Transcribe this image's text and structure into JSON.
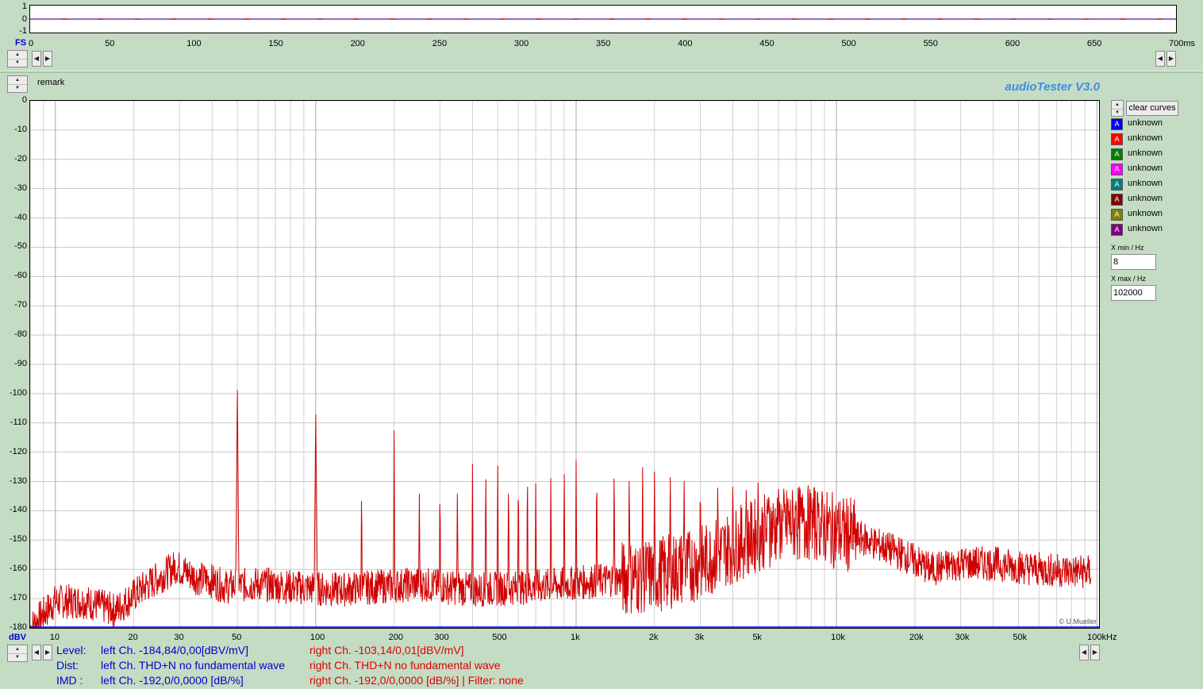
{
  "scope": {
    "y_ticks": [
      "1",
      "0",
      "-1"
    ],
    "unit_label": "FS",
    "x_ticks": [
      "0",
      "50",
      "100",
      "150",
      "200",
      "250",
      "300",
      "350",
      "400",
      "450",
      "500",
      "550",
      "600",
      "650",
      "700ms"
    ]
  },
  "header": {
    "remark": "remark",
    "brand": "audioTester  V3.0"
  },
  "chart_data": {
    "type": "line",
    "x_scale": "log",
    "xlim": [
      8,
      102000
    ],
    "ylim": [
      -180,
      0
    ],
    "ylabel": "dBV",
    "y_ticks": [
      "0",
      "-10",
      "-20",
      "-30",
      "-40",
      "-50",
      "-60",
      "-70",
      "-80",
      "-90",
      "-100",
      "-110",
      "-120",
      "-130",
      "-140",
      "-150",
      "-160",
      "-170",
      "-180"
    ],
    "x_tick_values": [
      10,
      20,
      30,
      50,
      100,
      200,
      300,
      500,
      1000,
      2000,
      3000,
      5000,
      10000,
      20000,
      30000,
      50000,
      100000
    ],
    "x_tick_labels": [
      "10",
      "20",
      "30",
      "50",
      "100",
      "200",
      "300",
      "500",
      "1k",
      "2k",
      "3k",
      "5k",
      "10k",
      "20k",
      "30k",
      "50k",
      "100kHz"
    ],
    "series": [
      {
        "color": "#d00000",
        "floor_points": [
          [
            8,
            -180
          ],
          [
            10,
            -171
          ],
          [
            13,
            -171
          ],
          [
            17,
            -174
          ],
          [
            22,
            -166
          ],
          [
            27,
            -161
          ],
          [
            29,
            -159
          ],
          [
            35,
            -163
          ],
          [
            40,
            -164
          ],
          [
            45,
            -166
          ],
          [
            60,
            -165
          ],
          [
            80,
            -166
          ],
          [
            120,
            -167
          ],
          [
            170,
            -166
          ],
          [
            250,
            -165
          ],
          [
            400,
            -167
          ],
          [
            700,
            -166
          ],
          [
            1200,
            -164
          ],
          [
            2000,
            -162
          ],
          [
            3000,
            -158
          ],
          [
            4000,
            -152
          ],
          [
            6000,
            -145
          ],
          [
            8000,
            -144
          ],
          [
            10000,
            -147
          ],
          [
            13000,
            -150
          ],
          [
            18000,
            -155
          ],
          [
            23000,
            -160
          ],
          [
            30000,
            -158
          ],
          [
            40000,
            -158
          ],
          [
            60000,
            -160
          ],
          [
            95000,
            -161
          ]
        ],
        "peaks": [
          [
            50,
            -96
          ],
          [
            100,
            -106
          ],
          [
            150,
            -130
          ],
          [
            200,
            -112
          ],
          [
            250,
            -131
          ],
          [
            300,
            -129
          ],
          [
            350,
            -132
          ],
          [
            400,
            -121
          ],
          [
            450,
            -122
          ],
          [
            500,
            -123
          ],
          [
            550,
            -125
          ],
          [
            600,
            -124
          ],
          [
            650,
            -122
          ],
          [
            700,
            -126
          ],
          [
            800,
            -124
          ],
          [
            900,
            -123
          ],
          [
            1000,
            -122
          ],
          [
            1200,
            -122
          ],
          [
            1400,
            -122
          ],
          [
            1600,
            -123
          ],
          [
            1800,
            -123
          ],
          [
            2000,
            -124
          ],
          [
            2300,
            -125
          ],
          [
            2600,
            -126
          ],
          [
            3000,
            -128
          ],
          [
            3500,
            -129
          ],
          [
            4000,
            -129
          ],
          [
            4500,
            -131
          ],
          [
            5000,
            -130
          ],
          [
            5500,
            -131
          ],
          [
            6000,
            -133
          ],
          [
            6500,
            -134
          ],
          [
            7000,
            -135
          ],
          [
            7500,
            -137
          ],
          [
            8000,
            -138
          ],
          [
            8500,
            -139
          ],
          [
            9000,
            -140
          ]
        ]
      }
    ]
  },
  "legend": {
    "clear_label": "clear curves",
    "items": [
      {
        "label": "unknown",
        "color": "#0000ff"
      },
      {
        "label": "unknown",
        "color": "#ff0000"
      },
      {
        "label": "unknown",
        "color": "#008000"
      },
      {
        "label": "unknown",
        "color": "#ff00ff"
      },
      {
        "label": "unknown",
        "color": "#008080"
      },
      {
        "label": "unknown",
        "color": "#800000"
      },
      {
        "label": "unknown",
        "color": "#808000"
      },
      {
        "label": "unknown",
        "color": "#800080"
      }
    ],
    "icon_glyph": "A"
  },
  "axis_settings": {
    "xmin_label": "X min / Hz",
    "xmin_value": "8",
    "xmax_label": "X max / Hz",
    "xmax_value": "102000"
  },
  "copyright": "© U.Mueller",
  "status": {
    "level_label": "Level:",
    "level_left": "left Ch. -184,84/0,00[dBV/mV]",
    "level_right": "right Ch. -103,14/0,01[dBV/mV]",
    "dist_label": "Dist:",
    "dist_left": "left Ch. THD+N  no fundamental wave",
    "dist_right": "right Ch. THD+N  no fundamental wave",
    "imd_label": "IMD  :",
    "imd_left": "left Ch. -192,0/0,0000 [dB/%]",
    "imd_right": "right Ch. -192,0/0,0000 [dB/%] |   Filter: none"
  }
}
